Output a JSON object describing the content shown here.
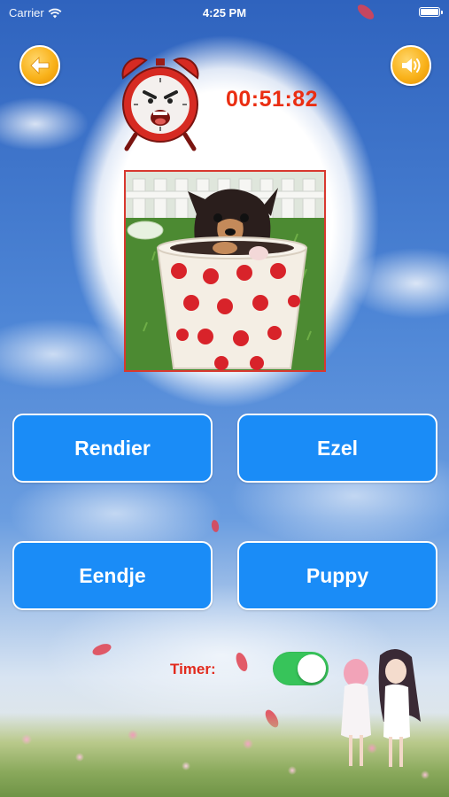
{
  "status_bar": {
    "carrier": "Carrier",
    "time": "4:25 PM"
  },
  "header": {
    "back_icon": "arrow-left-icon",
    "sound_icon": "speaker-volume-icon",
    "alarm_icon": "angry-alarm-clock-icon",
    "timer": "00:51:82"
  },
  "question": {
    "image_description_icon": "puppy-in-polka-dot-cup-image"
  },
  "answers": [
    {
      "label": "Rendier"
    },
    {
      "label": "Ezel"
    },
    {
      "label": "Eendje"
    },
    {
      "label": "Puppy"
    }
  ],
  "settings": {
    "timer_label": "Timer:",
    "timer_enabled": true
  },
  "colors": {
    "button_blue": "#1a8cf7",
    "timer_red": "#ea2e12",
    "toggle_green": "#37c45a",
    "round_button_orange": "#f9b21a"
  }
}
